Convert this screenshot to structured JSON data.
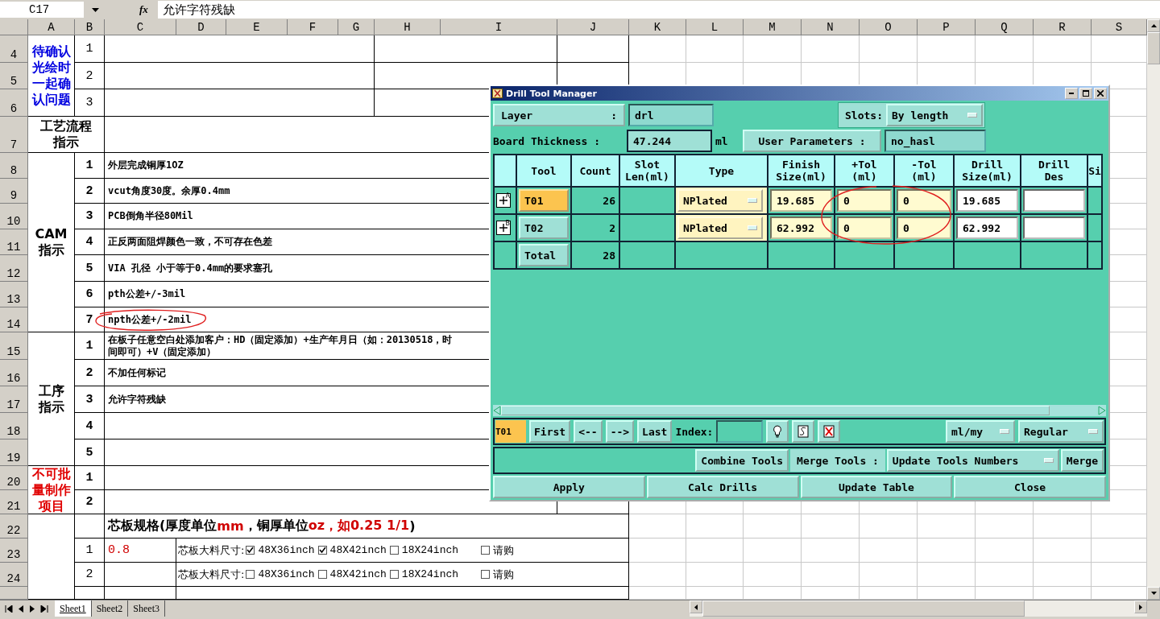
{
  "formula_bar": {
    "cell_ref": "C17",
    "function_label": "fx",
    "formula": "允许字符残缺"
  },
  "sheet": {
    "columns": [
      "A",
      "B",
      "C",
      "D",
      "E",
      "F",
      "G",
      "H",
      "I",
      "J",
      "K",
      "L",
      "M",
      "N",
      "O",
      "P",
      "Q",
      "R",
      "S"
    ],
    "row_numbers": [
      "4",
      "5",
      "6",
      "7",
      "8",
      "9",
      "10",
      "11",
      "12",
      "13",
      "14",
      "15",
      "16",
      "17",
      "18",
      "19",
      "20",
      "21",
      "22",
      "23",
      "24"
    ],
    "confirm": {
      "label": "待确认光绘时一起确认问题",
      "items": [
        "1",
        "2",
        "3"
      ]
    },
    "process": {
      "label": "工艺流程指示"
    },
    "cam": {
      "label": "CAM指示",
      "items": [
        {
          "no": "1",
          "text": "外层完成铜厚1OZ"
        },
        {
          "no": "2",
          "text": "vcut角度30度。余厚0.4mm"
        },
        {
          "no": "3",
          "text": "PCB倒角半径80Mil"
        },
        {
          "no": "4",
          "text": "正反两面阻焊颜色一致，不可存在色差"
        },
        {
          "no": "5",
          "text": "VIA 孔径 小于等于0.4mm的要求塞孔"
        },
        {
          "no": "6",
          "text": "pth公差+/-3mil"
        },
        {
          "no": "7",
          "text": "npth公差+/-2mil"
        }
      ]
    },
    "procedure": {
      "label": "工序指示",
      "items": [
        {
          "no": "1",
          "text": "在板子任意空白处添加客户：HD（固定添加）+生产年月日（如：20130518，时间即可）+V（固定添加）"
        },
        {
          "no": "2",
          "text": "不加任何标记"
        },
        {
          "no": "3",
          "text": "允许字符残缺"
        },
        {
          "no": "4"
        },
        {
          "no": "5"
        }
      ]
    },
    "no_batch": {
      "label": "不可批量制作项目",
      "items": [
        "1",
        "2"
      ]
    },
    "core": {
      "heading": [
        {
          "text": "芯板规格(厚度单位",
          "highlight": false
        },
        {
          "text": "mm",
          "highlight": true
        },
        {
          "text": "，铜厚单位",
          "highlight": false
        },
        {
          "text": "oz，如0.25 1/1",
          "highlight": true
        },
        {
          "text": ")",
          "highlight": false
        }
      ],
      "rows": [
        {
          "no": "1",
          "thickness": "0.8",
          "size_label": "芯板大料尺寸:",
          "options": [
            {
              "label": "48X36inch",
              "checked": true
            },
            {
              "label": "48X42inch",
              "checked": true
            },
            {
              "label": "18X24inch",
              "checked": false
            }
          ],
          "purchase": {
            "label": "请购",
            "checked": false
          }
        },
        {
          "no": "2",
          "size_label": "芯板大料尺寸:",
          "options": [
            {
              "label": "48X36inch",
              "checked": false
            },
            {
              "label": "48X42inch",
              "checked": false
            },
            {
              "label": "18X24inch",
              "checked": false
            }
          ],
          "purchase": {
            "label": "请购",
            "checked": false
          }
        }
      ]
    }
  },
  "sheet_tabs": [
    {
      "label": "Sheet1",
      "selected": true
    },
    {
      "label": "Sheet2",
      "selected": false
    },
    {
      "label": "Sheet3",
      "selected": false
    }
  ],
  "dialog": {
    "title": "Drill Tool Manager",
    "layer": {
      "label": "Layer",
      "separator": ":",
      "value": "drl"
    },
    "slots": {
      "label": "Slots:",
      "value": "By length"
    },
    "board_thickness": {
      "label": "Board Thickness :",
      "value": "47.244",
      "unit": "ml"
    },
    "user_parameters": {
      "label": "User Parameters :",
      "value": "no_hasl"
    },
    "columns": [
      "Tool",
      "Count",
      "Slot\nLen(ml)",
      "Type",
      "Finish\nSize(ml)",
      "+Tol\n(ml)",
      "-Tol\n(ml)",
      "Drill\nSize(ml)",
      "Drill\nDes",
      "Si"
    ],
    "tools": [
      {
        "marker": "A",
        "tool": "T01",
        "selected": true,
        "count": "26",
        "type": "NPlated",
        "finish_size": "19.685",
        "plus_tol": "0",
        "minus_tol": "0",
        "drill_size": "19.685"
      },
      {
        "marker": "B",
        "tool": "T02",
        "selected": false,
        "count": "2",
        "type": "NPlated",
        "finish_size": "62.992",
        "plus_tol": "0",
        "minus_tol": "0",
        "drill_size": "62.992"
      }
    ],
    "total": {
      "label": "Total",
      "count": "28"
    },
    "nav": {
      "current": "T01",
      "buttons": [
        "First",
        "<--",
        "-->",
        "Last"
      ],
      "index_label": "Index:",
      "units": "ml/my",
      "mode": "Regular"
    },
    "merge": {
      "combine": "Combine Tools",
      "label": "Merge Tools :",
      "option": "Update Tools Numbers",
      "button": "Merge"
    },
    "actions": [
      "Apply",
      "Calc Drills",
      "Update Table",
      "Close"
    ]
  }
}
